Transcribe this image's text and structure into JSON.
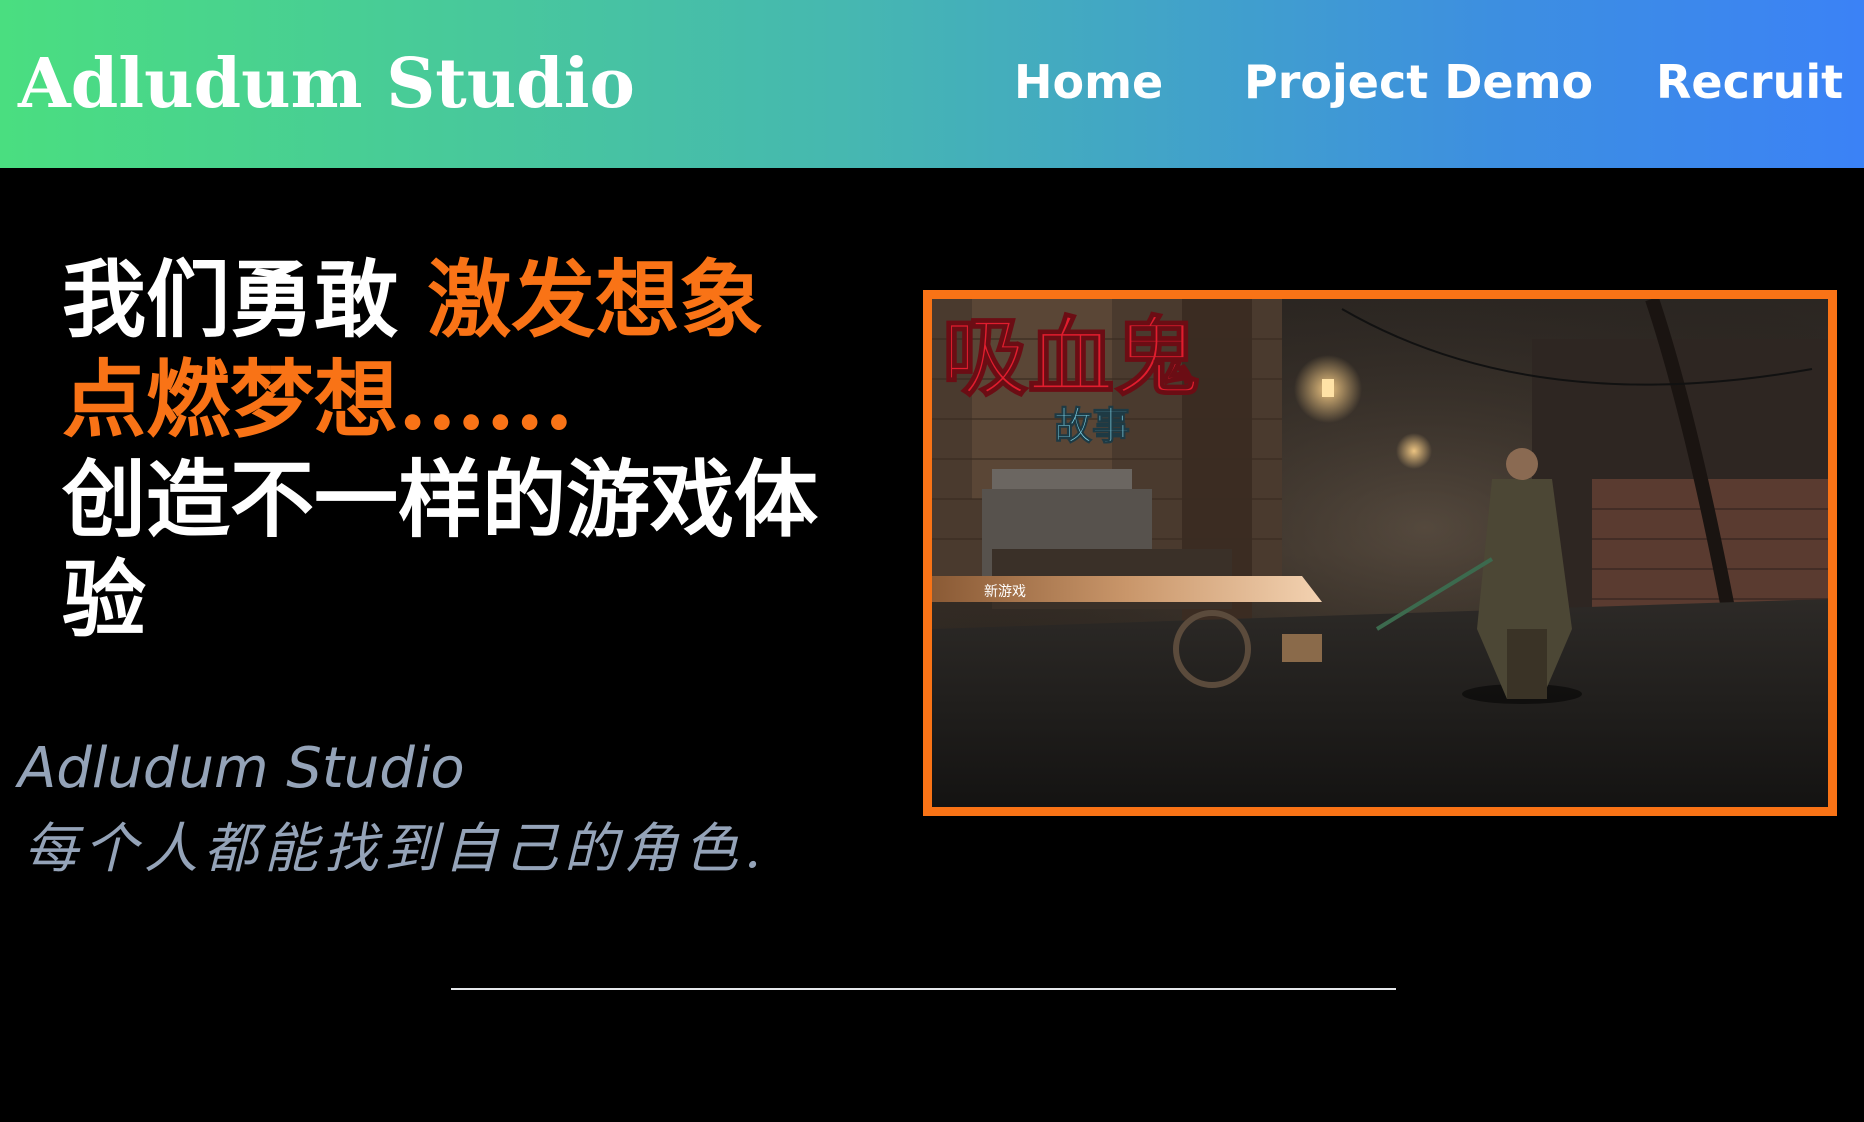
{
  "header": {
    "brand": "Adludum Studio",
    "nav": [
      {
        "label": "Home"
      },
      {
        "label": "Project Demo"
      },
      {
        "label": "Recruit"
      }
    ]
  },
  "hero": {
    "line1_white": "我们勇敢 ",
    "line1_orange": "激发想象",
    "line2_orange": "点燃梦想......",
    "line3_white": "创造不一样的游戏体",
    "line4_white": "验"
  },
  "studio": {
    "name": "Adludum Studio",
    "tagline": "每个人都能找到自己的角色."
  },
  "showcase": {
    "game_title": "吸血鬼",
    "game_subtitle": "故事",
    "menu_option": "新游戏"
  },
  "colors": {
    "accent": "#f97316",
    "nav_gradient_start": "#4ade80",
    "nav_gradient_end": "#3b82f6",
    "muted_text": "#94a3b8",
    "game_title_red": "#e11d2e",
    "game_subtitle_cyan": "#7dd3e8"
  }
}
